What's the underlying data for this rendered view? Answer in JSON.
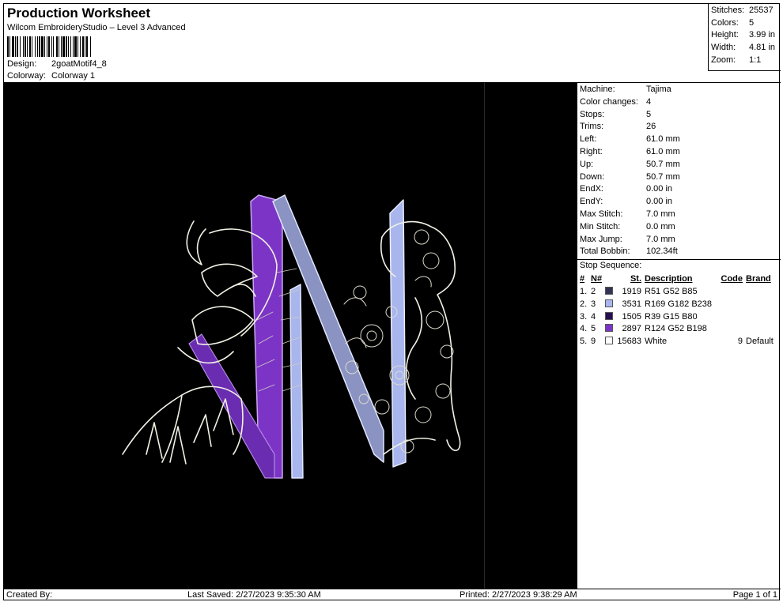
{
  "header": {
    "title": "Production Worksheet",
    "subtitle": "Wilcom EmbroideryStudio – Level 3 Advanced",
    "design_label": "Design:",
    "design_value": "2goatMotif4_8",
    "colorway_label": "Colorway:",
    "colorway_value": "Colorway 1"
  },
  "summary": [
    {
      "label": "Stitches:",
      "value": "25537"
    },
    {
      "label": "Colors:",
      "value": "5"
    },
    {
      "label": "Height:",
      "value": "3.99 in"
    },
    {
      "label": "Width:",
      "value": "4.81 in"
    },
    {
      "label": "Zoom:",
      "value": "1:1"
    }
  ],
  "machine_info": [
    {
      "label": "Machine:",
      "value": "Tajima"
    },
    {
      "label": "Color changes:",
      "value": "4"
    },
    {
      "label": "Stops:",
      "value": "5"
    },
    {
      "label": "Trims:",
      "value": "26"
    },
    {
      "label": "Left:",
      "value": "61.0 mm"
    },
    {
      "label": "Right:",
      "value": "61.0 mm"
    },
    {
      "label": "Up:",
      "value": "50.7 mm"
    },
    {
      "label": "Down:",
      "value": "50.7 mm"
    },
    {
      "label": "EndX:",
      "value": "0.00 in"
    },
    {
      "label": "EndY:",
      "value": "0.00 in"
    },
    {
      "label": "Max Stitch:",
      "value": "7.0 mm"
    },
    {
      "label": "Min Stitch:",
      "value": "0.0 mm"
    },
    {
      "label": "Max Jump:",
      "value": "7.0 mm"
    },
    {
      "label": "Total Bobbin:",
      "value": "102.34ft"
    }
  ],
  "stop_sequence": {
    "title": "Stop Sequence:",
    "headers": {
      "idx": "#",
      "needle": "N#",
      "stitches": "St.",
      "description": "Description",
      "code": "Code",
      "brand": "Brand"
    },
    "rows": [
      {
        "idx": "1.",
        "needle": "2",
        "color": "#333455",
        "stitches": "1919",
        "description": "R51 G52 B85",
        "code": "",
        "brand": ""
      },
      {
        "idx": "2.",
        "needle": "3",
        "color": "#A9B6EE",
        "stitches": "3531",
        "description": "R169 G182 B238",
        "code": "",
        "brand": ""
      },
      {
        "idx": "3.",
        "needle": "4",
        "color": "#270F50",
        "stitches": "1505",
        "description": "R39 G15 B80",
        "code": "",
        "brand": ""
      },
      {
        "idx": "4.",
        "needle": "5",
        "color": "#7C34C6",
        "stitches": "2897",
        "description": "R124 G52 B198",
        "code": "",
        "brand": ""
      },
      {
        "idx": "5.",
        "needle": "9",
        "color": "#FFFFFF",
        "stitches": "15683",
        "description": "White",
        "code": "9",
        "brand": "Default"
      }
    ]
  },
  "footer": {
    "created": "Created By:",
    "last_saved": "Last Saved: 2/27/2023 9:35:30 AM",
    "printed": "Printed: 2/27/2023 9:38:29 AM",
    "page": "Page 1 of 1"
  }
}
